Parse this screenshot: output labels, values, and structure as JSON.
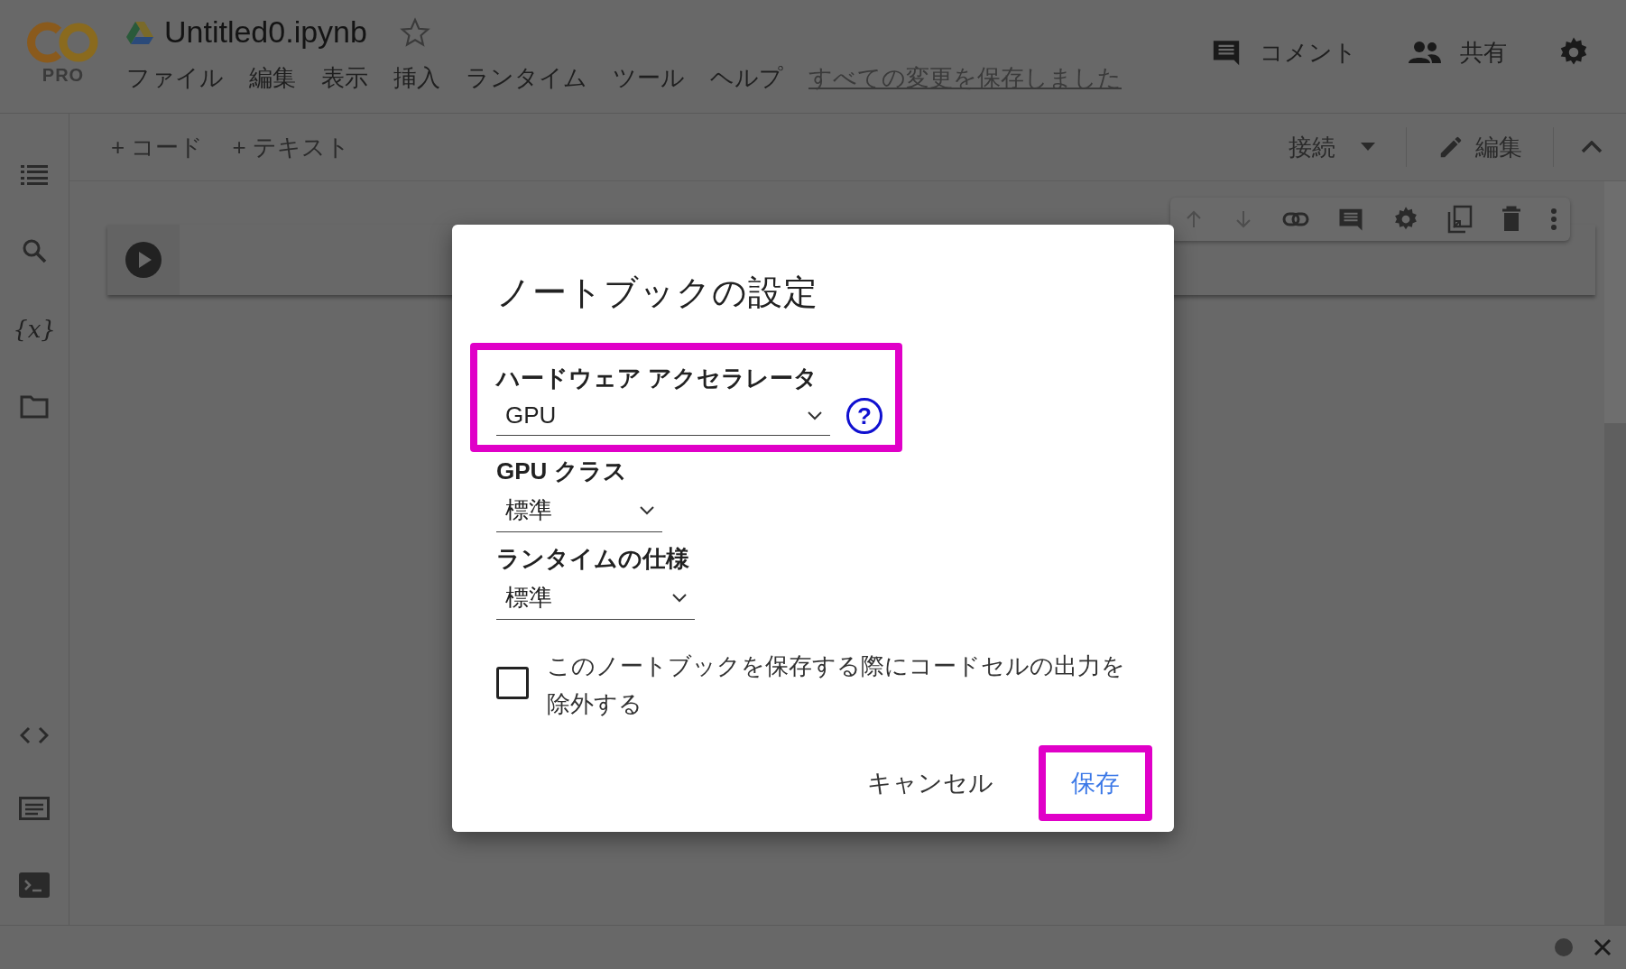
{
  "header": {
    "logo_badge": "PRO",
    "title": "Untitled0.ipynb",
    "starred": false,
    "menu": [
      "ファイル",
      "編集",
      "表示",
      "挿入",
      "ランタイム",
      "ツール",
      "ヘルプ"
    ],
    "save_status": "すべての変更を保存しました",
    "actions": [
      {
        "kind": "comment",
        "label": "コメント"
      },
      {
        "kind": "share",
        "label": "共有"
      },
      {
        "kind": "settings"
      }
    ]
  },
  "toolbar": {
    "add_buttons": [
      "+ コード",
      "+ テキスト"
    ],
    "connect": "接続",
    "edit": "編集"
  },
  "sidebar": {
    "variables_icon": "{x}"
  },
  "cell_toolbar": [
    {
      "kind": "up",
      "disabled": true
    },
    {
      "kind": "down",
      "disabled": true
    },
    {
      "kind": "link",
      "disabled": false
    },
    {
      "kind": "comment",
      "disabled": false
    },
    {
      "kind": "settings",
      "disabled": false
    },
    {
      "kind": "mirror",
      "disabled": false
    },
    {
      "kind": "delete",
      "disabled": false
    },
    {
      "kind": "more",
      "disabled": false
    }
  ],
  "dialog": {
    "title": "ノートブックの設定",
    "fields": [
      {
        "label": "ハードウェア アクセラレータ",
        "value": "GPU",
        "help": "?",
        "highlighted": true
      },
      {
        "label": "GPU クラス",
        "value": "標準",
        "highlighted": false
      },
      {
        "label": "ランタイムの仕様",
        "value": "標準",
        "highlighted": false
      }
    ],
    "checkbox": {
      "label": "このノートブックを保存する際にコードセルの出力を除外する",
      "checked": false
    },
    "buttons": [
      {
        "label": "キャンセル",
        "kind": "secondary",
        "highlighted": false
      },
      {
        "label": "保存",
        "kind": "primary",
        "highlighted": true
      }
    ]
  }
}
